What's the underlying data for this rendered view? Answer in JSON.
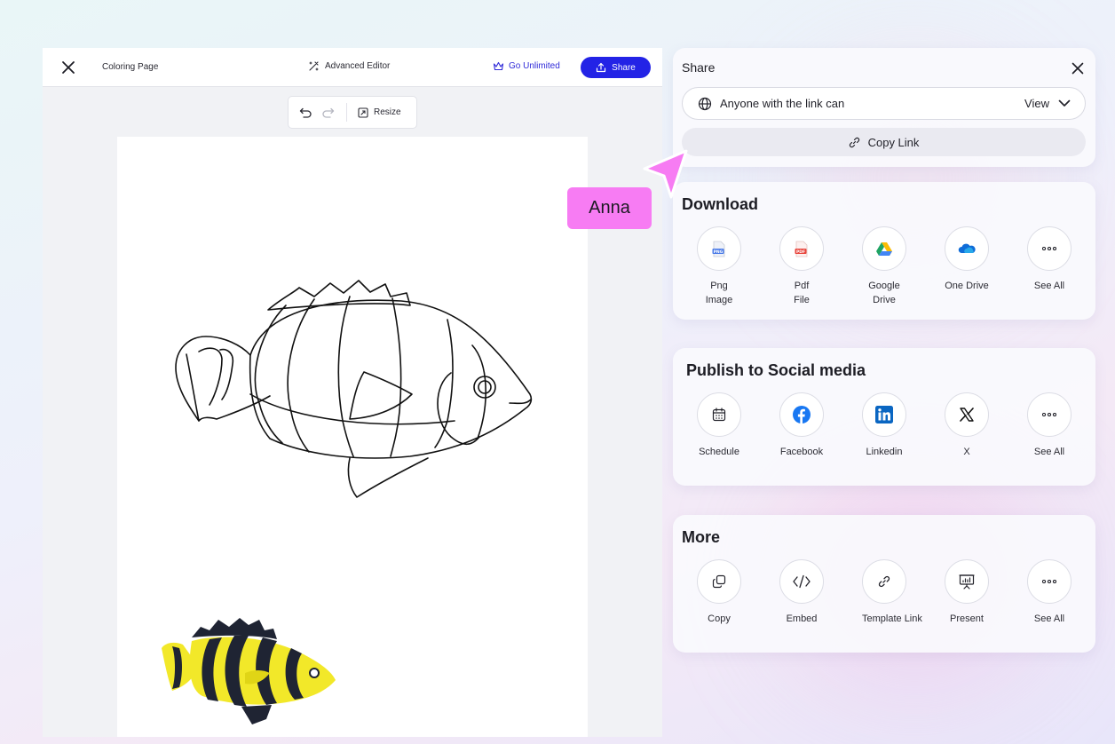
{
  "editor": {
    "doc_title": "Coloring Page",
    "advanced_editor": "Advanced Editor",
    "go_unlimited": "Go Unlimited",
    "share_label": "Share",
    "toolbar": {
      "resize_label": "Resize"
    }
  },
  "share": {
    "title": "Share",
    "access_text": "Anyone with the link can",
    "access_value": "View",
    "copy_link_label": "Copy Link"
  },
  "download": {
    "title": "Download",
    "items": [
      {
        "label": "Png\nImage",
        "icon": "png-file-icon"
      },
      {
        "label": "Pdf\nFile",
        "icon": "pdf-file-icon"
      },
      {
        "label": "Google\nDrive",
        "icon": "google-drive-icon"
      },
      {
        "label": "One Drive",
        "icon": "onedrive-icon"
      },
      {
        "label": "See All",
        "icon": "more-icon"
      }
    ]
  },
  "social": {
    "title": "Publish to Social media",
    "items": [
      {
        "label": "Schedule",
        "icon": "calendar-icon"
      },
      {
        "label": "Facebook",
        "icon": "facebook-icon"
      },
      {
        "label": "Linkedin",
        "icon": "linkedin-icon"
      },
      {
        "label": "X",
        "icon": "x-icon"
      },
      {
        "label": "See All",
        "icon": "more-icon"
      }
    ]
  },
  "more": {
    "title": "More",
    "items": [
      {
        "label": "Copy",
        "icon": "copy-icon"
      },
      {
        "label": "Embed",
        "icon": "embed-code-icon"
      },
      {
        "label": "Template Link",
        "icon": "link-icon"
      },
      {
        "label": "Present",
        "icon": "presentation-icon"
      },
      {
        "label": "See All",
        "icon": "more-icon"
      }
    ]
  },
  "collaborator": {
    "name": "Anna",
    "color": "#f77cf3"
  },
  "colors": {
    "accent": "#2323e6",
    "fish_yellow": "#f2e829",
    "fish_stripe": "#1f2433"
  }
}
